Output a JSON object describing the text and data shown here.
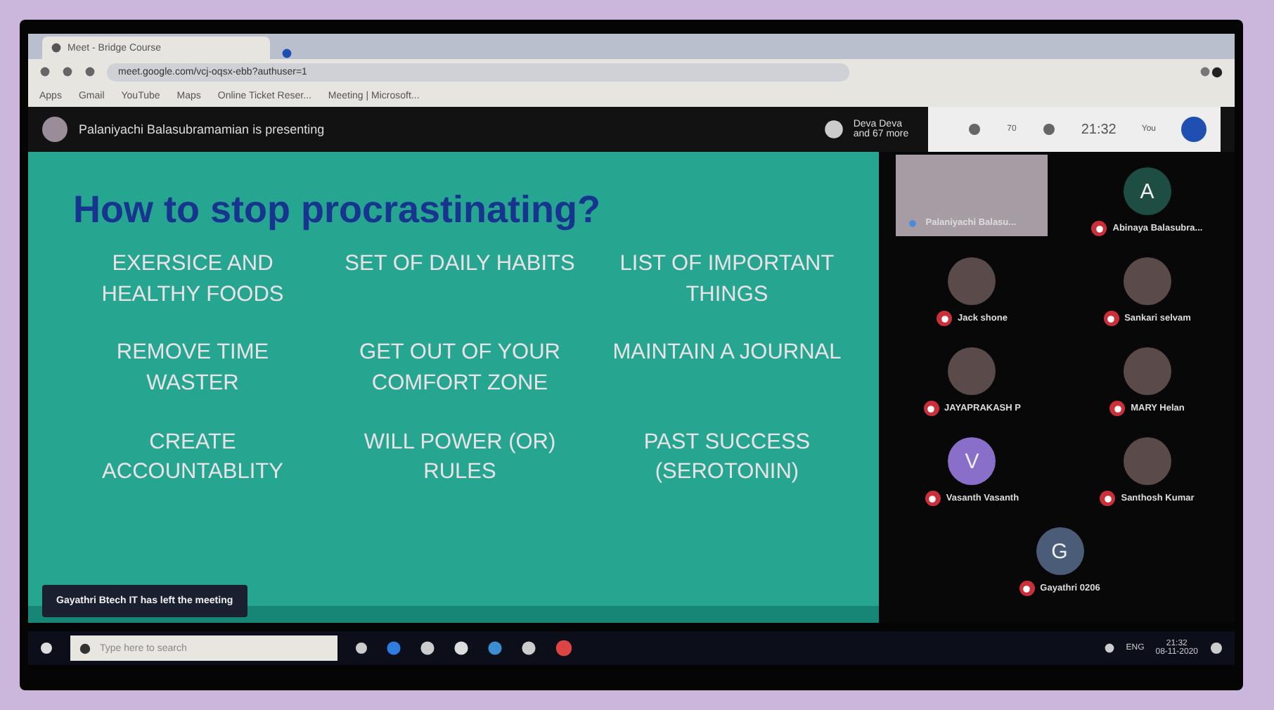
{
  "browser": {
    "tab_title": "Meet - Bridge Course",
    "url": "meet.google.com/vcj-oqsx-ebb?authuser=1",
    "bookmarks": [
      "Apps",
      "Gmail",
      "YouTube",
      "Maps",
      "Online Ticket Reser...",
      "Meeting | Microsoft..."
    ]
  },
  "meet_bar": {
    "presenting": "Palaniyachi Balasubramamian is presenting",
    "others_line1": "Deva Deva",
    "others_line2": "and 67 more",
    "people_count": "70",
    "time": "21:32",
    "self_label": "You"
  },
  "slide": {
    "title": "How to stop procrastinating?",
    "items": [
      "EXERSICE AND HEALTHY FOODS",
      "SET OF DAILY HABITS",
      "LIST OF IMPORTANT THINGS",
      "REMOVE TIME WASTER",
      "GET OUT OF YOUR COMFORT ZONE",
      "MAINTAIN A JOURNAL",
      "CREATE ACCOUNTABLITY",
      "WILL POWER (OR) RULES",
      "PAST SUCCESS (SEROTONIN)"
    ]
  },
  "toast": "Gayathri Btech IT has left the meeting",
  "participants": [
    {
      "name": "Palaniyachi Balasu...",
      "kind": "video",
      "muted": false
    },
    {
      "name": "Abinaya Balasubra...",
      "kind": "letter",
      "letter": "A",
      "color": "#1e4d44",
      "muted": true
    },
    {
      "name": "Jack shone",
      "kind": "photo",
      "muted": true
    },
    {
      "name": "Sankari selvam",
      "kind": "photo",
      "muted": true
    },
    {
      "name": "JAYAPRAKASH P",
      "kind": "photo",
      "muted": true
    },
    {
      "name": "MARY Helan",
      "kind": "photo",
      "muted": true
    },
    {
      "name": "Vasanth Vasanth",
      "kind": "letter",
      "letter": "V",
      "color": "#8a6fc9",
      "muted": true
    },
    {
      "name": "Santhosh Kumar",
      "kind": "photo",
      "muted": true
    },
    {
      "name": "Gayathri 0206",
      "kind": "letter",
      "letter": "G",
      "color": "#4b5c78",
      "muted": true
    }
  ],
  "taskbar": {
    "search_placeholder": "Type here to search",
    "language": "ENG",
    "time": "21:32",
    "date": "08-11-2020"
  }
}
